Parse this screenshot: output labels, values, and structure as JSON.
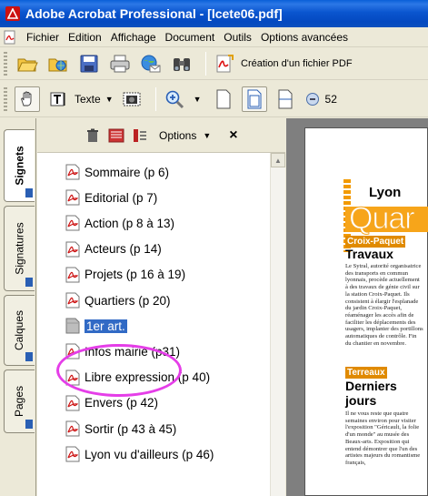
{
  "window": {
    "title": "Adobe Acrobat Professional - [lcete06.pdf]"
  },
  "menu": [
    "Fichier",
    "Edition",
    "Affichage",
    "Document",
    "Outils",
    "Options avancées"
  ],
  "toolbar": {
    "create_pdf_label": "Création d'un fichier PDF",
    "texte_label": "Texte",
    "zoom_value": "52"
  },
  "left_tabs": [
    "Signets",
    "Signatures",
    "Calques",
    "Pages"
  ],
  "panel": {
    "options_label": "Options",
    "close_symbol": "×",
    "bookmarks": [
      {
        "label": "Sommaire (p 6)"
      },
      {
        "label": "Editorial (p 7)"
      },
      {
        "label": "Action (p 8 à 13)"
      },
      {
        "label": "Acteurs (p 14)"
      },
      {
        "label": "Projets (p 16 à 19)"
      },
      {
        "label": "Quartiers (p 20)"
      },
      {
        "label": "1er art.",
        "selected": true
      },
      {
        "label": "Infos mairie (p31)"
      },
      {
        "label": "Libre expression (p 40)"
      },
      {
        "label": "Envers (p 42)"
      },
      {
        "label": "Sortir (p 43 à 45)"
      },
      {
        "label": "Lyon vu d'ailleurs (p 46)"
      }
    ]
  },
  "document": {
    "title_small": "Lyon",
    "title_big": "Quar",
    "tag1": "Croix-Paquet",
    "heading1": "Travaux",
    "body1": "Le Sytral, autorité organisatrice des transports en commun lyonnais, procède actuellement à des travaux de génie civil sur la station Croix-Paquet. Ils consistent à élargir l'esplanade du jardin Croix-Paquet, réaménager les accès afin de faciliter les déplacements des usagers, implanter des portillons automatiques de contrôle. Fin du chantier en novembre.",
    "tag2": "Terreaux",
    "heading2a": "Derniers",
    "heading2b": "jours",
    "body2": "Il ne vous reste que quatre semaines environ pour visiter l'exposition \"Géricault, la folie d'un monde\" au musée des Beaux-arts. Exposition qui entend démontrer que l'un des artistes majeurs du romantisme français,"
  },
  "colors": {
    "titlebar": "#0a55cf",
    "selection": "#316ac5",
    "ellipse": "#e53ee8",
    "accent_orange": "#f29a00"
  },
  "icons": [
    "pdf-icon",
    "open-folder-icon",
    "save-icon",
    "print-icon",
    "email-icon",
    "binoculars-icon",
    "create-pdf-icon",
    "hand-icon",
    "text-select-icon",
    "snapshot-icon",
    "zoom-in-icon",
    "single-page-icon",
    "fit-page-icon",
    "fit-width-icon",
    "zoom-out-icon",
    "trash-icon",
    "new-bookmark-icon",
    "expand-bookmark-icon"
  ]
}
